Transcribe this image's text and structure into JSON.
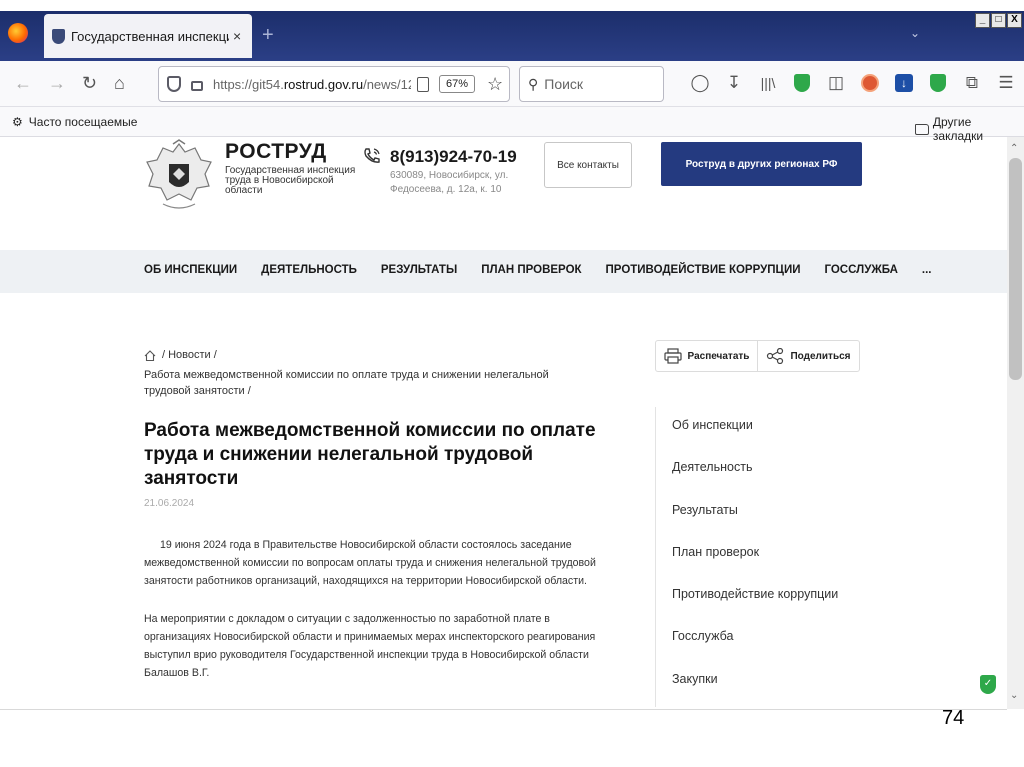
{
  "browser": {
    "tab_title": "Государственная инспекция труда в Новосибирской области",
    "tab_close": "×",
    "new_tab": "+",
    "url_prefix": "https://git54.",
    "url_domain": "rostrud.gov.ru",
    "url_rest": "/news/12",
    "zoom": "67%",
    "search_placeholder": "Поиск",
    "bookmark_left": "Часто посещаемые",
    "bookmark_right": "Другие закладки",
    "window_controls": [
      "_",
      "□",
      "X"
    ]
  },
  "site": {
    "logo_title": "РОСТРУД",
    "logo_subtitle": "Государственная инспекция труда в Новосибирской области",
    "phone": "8(913)924-70-19",
    "address": "630089, Новосибирск, ул. Федосеева, д. 12а, к. 10",
    "contacts_button": "Все контакты",
    "regions_button": "Роструд в других регионах РФ",
    "menu": [
      "ОБ ИНСПЕКЦИИ",
      "ДЕЯТЕЛЬНОСТЬ",
      "РЕЗУЛЬТАТЫ",
      "ПЛАН ПРОВЕРОК",
      "ПРОТИВОДЕЙСТВИЕ КОРРУПЦИИ",
      "ГОССЛУЖБА",
      "..."
    ]
  },
  "article": {
    "breadcrumb_news": "/  Новости  /",
    "breadcrumb_current": "Работа межведомственной комиссии по оплате труда и снижении нелегальной трудовой занятости  /",
    "print_label": "Распечатать",
    "share_label": "Поделиться",
    "title": "Работа межведомственной комиссии по оплате труда и снижении нелегальной трудовой занятости",
    "date": "21.06.2024",
    "paragraph1": "19 июня 2024 года в Правительстве Новосибирской области состоялось заседание межведомственной комиссии по вопросам оплаты труда и снижения нелегальной трудовой занятости работников организаций, находящихся на территории Новосибирской области.",
    "paragraph2": "На мероприятии с докладом о ситуации с задолженностью по заработной плате в организациях Новосибирской области и принимаемых мерах инспекторского реагирования выступил врио руководителя Государственной инспекции труда в Новосибирской области Балашов В.Г."
  },
  "sidenav": [
    "Об инспекции",
    "Деятельность",
    "Результаты",
    "План проверок",
    "Противодействие коррупции",
    "Госслужба",
    "Закупки"
  ],
  "slide_number": "74",
  "colors": {
    "accent": "#243a80",
    "tabbar": "#1c2e6b",
    "menu_bg": "#eef1f4"
  }
}
